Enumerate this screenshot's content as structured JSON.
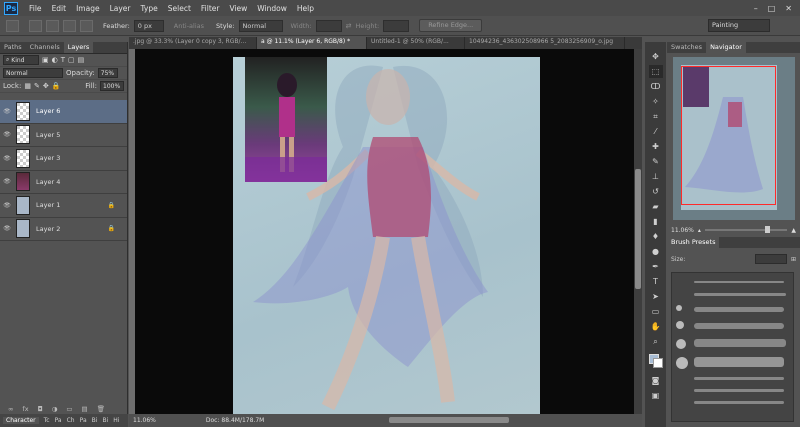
{
  "app": {
    "logo": "Ps"
  },
  "menu": [
    "File",
    "Edit",
    "Image",
    "Layer",
    "Type",
    "Select",
    "Filter",
    "View",
    "Window",
    "Help"
  ],
  "window_controls": [
    "–",
    "□",
    "✕"
  ],
  "options": {
    "feather_label": "Feather:",
    "feather_value": "0 px",
    "antialias": "Anti-alias",
    "style_label": "Style:",
    "style_value": "Normal",
    "width_label": "Width:",
    "height_label": "Height:",
    "refine_edge": "Refine Edge...",
    "workspace": "Painting"
  },
  "left_panel": {
    "tabs": [
      "Paths",
      "Channels",
      "Layers"
    ],
    "kind": "Kind",
    "blend_mode": "Normal",
    "opacity_label": "Opacity:",
    "opacity_value": "75%",
    "lock_label": "Lock:",
    "fill_label": "Fill:",
    "fill_value": "100%",
    "layers": [
      {
        "name": "Layer 6",
        "selected": true,
        "thumb": "checker"
      },
      {
        "name": "Layer 5",
        "selected": false,
        "thumb": "checker"
      },
      {
        "name": "Layer 3",
        "selected": false,
        "thumb": "checker"
      },
      {
        "name": "Layer 4",
        "selected": false,
        "thumb": "photo"
      },
      {
        "name": "Layer 1",
        "selected": false,
        "thumb": "blue",
        "locked": true
      },
      {
        "name": "Layer 2",
        "selected": false,
        "thumb": "blue",
        "locked": true
      }
    ],
    "bottom_icons": [
      "∞",
      "fx",
      "◘",
      "◑",
      "▭",
      "▤",
      "🗑"
    ]
  },
  "doc_tabs": [
    {
      "label": ".jpg @ 33.3% (Layer 0 copy 3, RGB/...",
      "active": false
    },
    {
      "label": "a @ 11.1% (Layer 6, RGB/8) *",
      "active": true
    },
    {
      "label": "Untitled-1 @ 50% (RGB/...",
      "active": false
    },
    {
      "label": "10494236_436302508966 5_2083256909_o.jpg",
      "active": false
    }
  ],
  "status": {
    "zoom": "11.06%",
    "doc": "Doc: 88.4M/178.7M"
  },
  "bottom_left": {
    "tab": "Character",
    "items": [
      "Tc",
      "Pa",
      "Ch",
      "Pa",
      "Bi",
      "Bi",
      "Hi"
    ]
  },
  "right_panel": {
    "nav_tabs": [
      "Swatches",
      "Navigator"
    ],
    "nav_zoom": "11.06%",
    "brush_tab": "Brush Presets",
    "size_label": "Size:"
  },
  "colors": {
    "foreground": "#a8bdd5",
    "background": "#ffffff",
    "selected_layer": "#5c6d86"
  }
}
